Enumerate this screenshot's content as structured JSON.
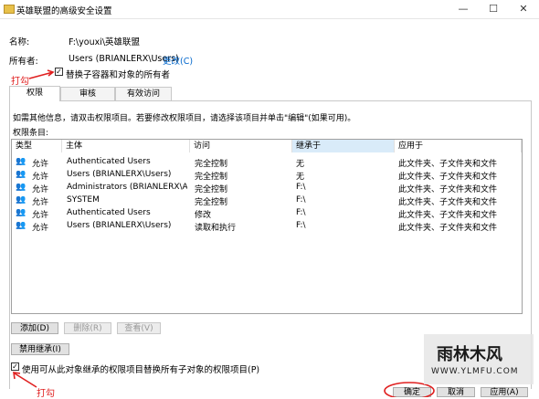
{
  "window": {
    "title": "英雄联盟的高级安全设置",
    "minimize": "—",
    "maximize": "☐",
    "close": "✕"
  },
  "info": {
    "name_label": "名称:",
    "name_value": "F:\\youxi\\英雄联盟",
    "owner_label": "所有者:",
    "owner_value": "Users (BRIANLERX\\Users)",
    "change_link": "更改(C)",
    "replace_owner_label": "替换子容器和对象的所有者",
    "replace_owner_checked": true
  },
  "annotations": {
    "top": "打勾",
    "bottom": "打勾"
  },
  "tabs": [
    {
      "label": "权限",
      "active": true
    },
    {
      "label": "审核",
      "active": false
    },
    {
      "label": "有效访问",
      "active": false
    }
  ],
  "instructions": "如需其他信息，请双击权限项目。若要修改权限项目，请选择该项目并单击\"编辑\"(如果可用)。",
  "entries_label": "权限条目:",
  "columns": [
    "类型",
    "主体",
    "访问",
    "继承于",
    "应用于"
  ],
  "rows": [
    {
      "type": "允许",
      "principal": "Authenticated Users",
      "access": "完全控制",
      "inherited": "无",
      "applies": "此文件夹、子文件夹和文件"
    },
    {
      "type": "允许",
      "principal": "Users (BRIANLERX\\Users)",
      "access": "完全控制",
      "inherited": "无",
      "applies": "此文件夹、子文件夹和文件"
    },
    {
      "type": "允许",
      "principal": "Administrators (BRIANLERX\\Ad...",
      "access": "完全控制",
      "inherited": "F:\\",
      "applies": "此文件夹、子文件夹和文件"
    },
    {
      "type": "允许",
      "principal": "SYSTEM",
      "access": "完全控制",
      "inherited": "F:\\",
      "applies": "此文件夹、子文件夹和文件"
    },
    {
      "type": "允许",
      "principal": "Authenticated Users",
      "access": "修改",
      "inherited": "F:\\",
      "applies": "此文件夹、子文件夹和文件"
    },
    {
      "type": "允许",
      "principal": "Users (BRIANLERX\\Users)",
      "access": "读取和执行",
      "inherited": "F:\\",
      "applies": "此文件夹、子文件夹和文件"
    }
  ],
  "buttons": {
    "add": "添加(D)",
    "remove": "删除(R)",
    "view": "查看(V)",
    "disable_inheritance": "禁用继承(I)",
    "ok": "确定",
    "cancel": "取消",
    "apply": "应用(A)"
  },
  "replace_child": {
    "label": "使用可从此对象继承的权限项目替换所有子对象的权限项目(P)",
    "checked": true
  },
  "watermark": {
    "text": "雨林木风",
    "url": "WWW.YLMFU.COM"
  },
  "colors": {
    "annotation": "#e02020",
    "link": "#0066cc",
    "header_selected": "#d9ebf9"
  }
}
